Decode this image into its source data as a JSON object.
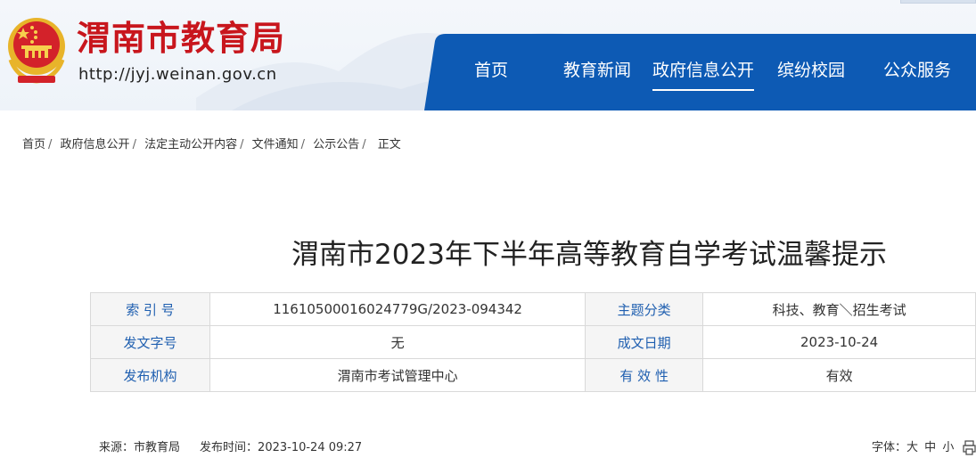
{
  "header": {
    "site_title": "渭南市教育局",
    "site_url": "http://jyj.weinan.gov.cn",
    "emblem_icon": "national-emblem-icon",
    "brand_color": "#c8161d",
    "nav_color": "#0d5ab4"
  },
  "nav": {
    "items": [
      {
        "label": "首页"
      },
      {
        "label": "教育新闻"
      },
      {
        "label": "政府信息公开"
      },
      {
        "label": "缤纷校园"
      },
      {
        "label": "公众服务"
      }
    ],
    "active": "政府信息公开"
  },
  "breadcrumb": {
    "items": [
      "首页",
      "政府信息公开",
      "法定主动公开内容",
      "文件通知",
      "公示公告",
      "正文"
    ]
  },
  "article": {
    "title": "渭南市2023年下半年高等教育自学考试温馨提示"
  },
  "info": {
    "rows": [
      {
        "l1": "索 引 号",
        "v1": "11610500016024779G/2023-094342",
        "l2": "主题分类",
        "v2": "科技、教育＼招生考试"
      },
      {
        "l1": "发文字号",
        "v1": "无",
        "l2": "成文日期",
        "v2": "2023-10-24"
      },
      {
        "l1": "发布机构",
        "v1": "渭南市考试管理中心",
        "l2": "有 效 性",
        "v2": "有效"
      }
    ]
  },
  "meta": {
    "source_label": "来源：",
    "source_value": "市教育局",
    "time_label": "发布时间：",
    "time_value": "2023-10-24 09:27",
    "font_label": "字体：",
    "font_large": "大",
    "font_medium": "中",
    "font_small": "小",
    "print_icon": "print-icon"
  }
}
